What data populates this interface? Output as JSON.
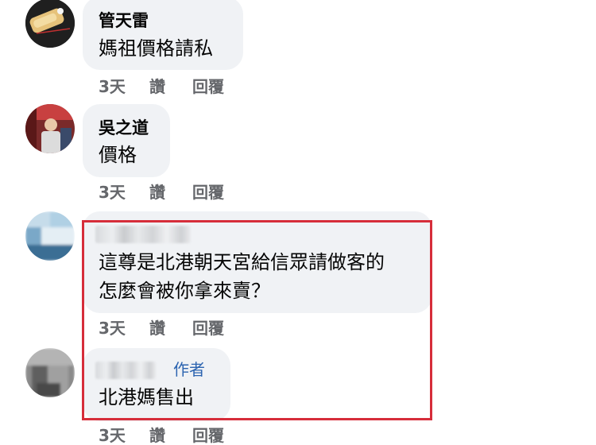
{
  "comments": [
    {
      "name": "管天雷",
      "text": "媽祖價格請私",
      "time": "3天",
      "like": "讚",
      "reply": "回覆"
    },
    {
      "name": "吳之道",
      "text": "價格",
      "time": "3天",
      "like": "讚",
      "reply": "回覆"
    },
    {
      "text_line1": "這尊是北港朝天宮給信眾請做客的",
      "text_line2": "怎麼會被你拿來賣？",
      "time": "3天",
      "like": "讚",
      "reply": "回覆"
    },
    {
      "author_badge": "作者",
      "text": "北港媽售出",
      "time": "3天",
      "like": "讚",
      "reply": "回覆"
    }
  ],
  "colors": {
    "highlight_border": "#d62d3a",
    "bubble": "#f0f2f5",
    "author_badge": "#2c64b0",
    "meta_text": "#65676b"
  }
}
